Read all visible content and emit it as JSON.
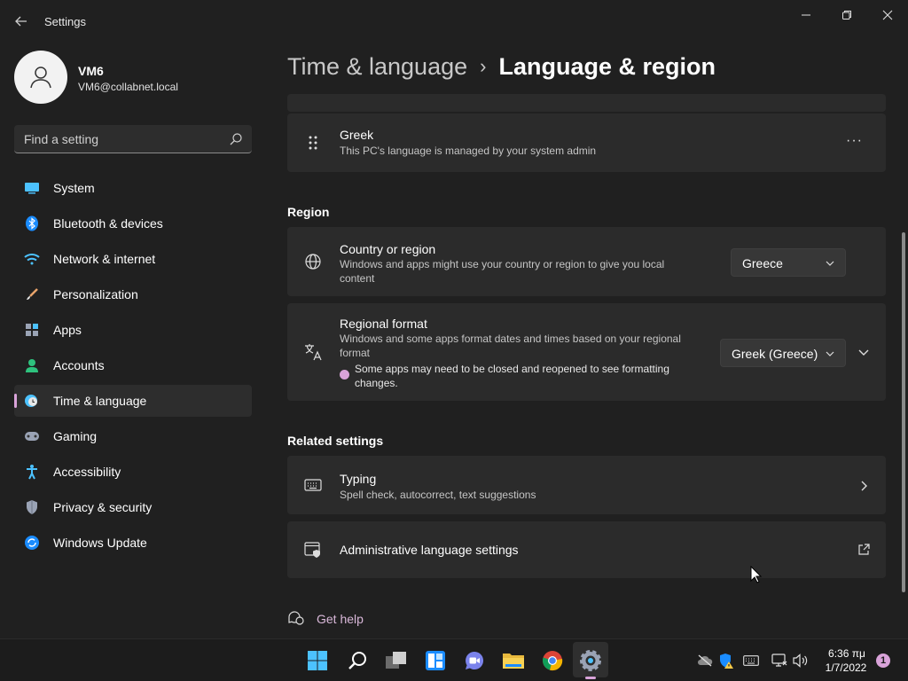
{
  "app": {
    "title": "Settings"
  },
  "window_controls": {
    "minimize": "minimize-icon",
    "maximize": "restore-icon",
    "close": "close-icon"
  },
  "profile": {
    "name": "VM6",
    "email": "VM6@collabnet.local"
  },
  "search": {
    "placeholder": "Find a setting"
  },
  "sidebar": {
    "items": [
      {
        "label": "System",
        "icon": "system-icon"
      },
      {
        "label": "Bluetooth & devices",
        "icon": "bluetooth-icon"
      },
      {
        "label": "Network & internet",
        "icon": "network-icon"
      },
      {
        "label": "Personalization",
        "icon": "personalization-icon"
      },
      {
        "label": "Apps",
        "icon": "apps-icon"
      },
      {
        "label": "Accounts",
        "icon": "accounts-icon"
      },
      {
        "label": "Time & language",
        "icon": "time-language-icon",
        "selected": true
      },
      {
        "label": "Gaming",
        "icon": "gaming-icon"
      },
      {
        "label": "Accessibility",
        "icon": "accessibility-icon"
      },
      {
        "label": "Privacy & security",
        "icon": "privacy-icon"
      },
      {
        "label": "Windows Update",
        "icon": "windows-update-icon"
      }
    ]
  },
  "breadcrumb": {
    "parent": "Time & language",
    "separator": "›",
    "current": "Language & region"
  },
  "language_card": {
    "title": "Greek",
    "subtitle": "This PC's language is managed by your system admin",
    "menu": "···"
  },
  "region": {
    "heading": "Region",
    "country": {
      "title": "Country or region",
      "subtitle_line1": "Windows and apps might use your country or region to give you local",
      "subtitle_line2": "content",
      "value": "Greece"
    },
    "format": {
      "title": "Regional format",
      "subtitle_line1": "Windows and some apps format dates and times based on your regional",
      "subtitle_line2": "format",
      "note_line1": "Some apps may need to be closed and reopened to see formatting",
      "note_line2": "changes.",
      "value": "Greek (Greece)"
    }
  },
  "related": {
    "heading": "Related settings",
    "typing": {
      "title": "Typing",
      "subtitle": "Spell check, autocorrect, text suggestions"
    },
    "admin": {
      "title": "Administrative language settings"
    }
  },
  "help": {
    "label": "Get help"
  },
  "taskbar": {
    "apps": [
      "start-icon",
      "search-icon",
      "task-view-icon",
      "widgets-icon",
      "chat-icon",
      "file-explorer-icon",
      "chrome-icon",
      "settings-icon"
    ],
    "tray": [
      "onedrive-offline-icon",
      "defender-icon",
      "keyboard-icon",
      "network-icon",
      "volume-icon"
    ],
    "time": "6:36 πμ",
    "date": "1/7/2022",
    "notifications": "1"
  },
  "colors": {
    "accent": "#d9a3d9",
    "background": "#202020",
    "card": "#2b2b2b"
  }
}
